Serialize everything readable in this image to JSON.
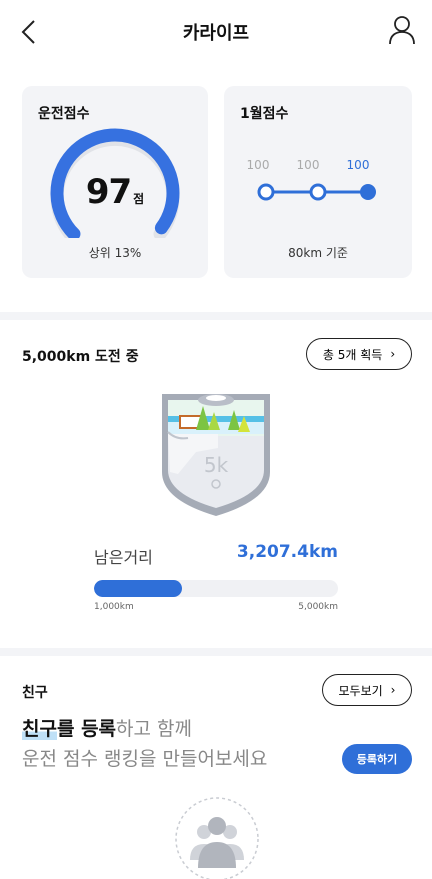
{
  "header": {
    "title": "카라이프"
  },
  "score": {
    "title": "운전점수",
    "value": "97",
    "unit": "점",
    "rank": "상위 13%",
    "gauge_fraction": 0.97,
    "gauge_color": "#3671e0"
  },
  "monthly": {
    "title": "1월점수",
    "points": [
      "100",
      "100",
      "100"
    ],
    "basis": "80km 기준",
    "accent": "#2f6fd8"
  },
  "challenge": {
    "title": "5,000km 도전 중",
    "acquired_label": "총 5개 획득",
    "badge_text": "5k",
    "remaining_label": "남은거리",
    "remaining_value": "3,207.4km",
    "progress_fraction": 0.36,
    "range_min": "1,000km",
    "range_max": "5,000km"
  },
  "friends": {
    "title": "친구",
    "view_all_label": "모두보기",
    "promo_highlight": "친구",
    "promo_particle": "를 ",
    "promo_bold": "등록",
    "promo_rest": "하고 함께",
    "promo_line2": "운전 점수 랭킹을 만들어보세요",
    "register_label": "등록하기"
  }
}
